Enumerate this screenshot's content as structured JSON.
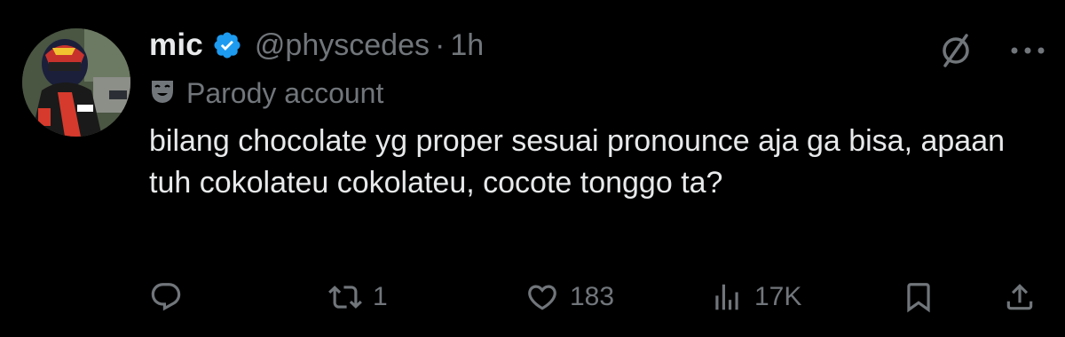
{
  "author": {
    "name": "mic",
    "handle": "@physcedes",
    "separator": "·",
    "time": "1h",
    "verified": true,
    "verified_color": "#1d9bf0"
  },
  "label": {
    "icon": "theater-mask-icon",
    "text": "Parody account"
  },
  "tweet": {
    "text": "bilang chocolate yg proper sesuai pronounce aja ga bisa, apaan tuh cokolateu cokolateu, cocote tonggo ta?"
  },
  "header_icons": [
    "grok-icon",
    "more-icon"
  ],
  "actions": {
    "reply": {
      "icon": "reply-icon",
      "count": ""
    },
    "repost": {
      "icon": "repost-icon",
      "count": "1"
    },
    "like": {
      "icon": "heart-icon",
      "count": "183"
    },
    "views": {
      "icon": "views-icon",
      "count": "17K"
    },
    "bookmark": {
      "icon": "bookmark-icon",
      "count": ""
    },
    "share": {
      "icon": "share-icon",
      "count": ""
    }
  },
  "colors": {
    "background": "#000000",
    "text": "#e7e9ea",
    "muted": "#71767b",
    "verified": "#1d9bf0"
  }
}
